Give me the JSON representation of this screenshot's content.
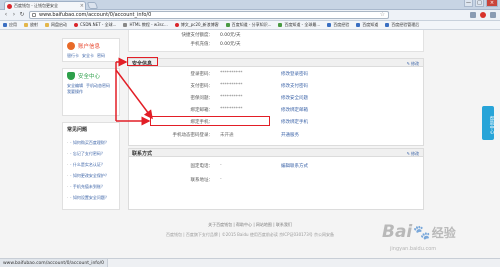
{
  "browser": {
    "tab_title": "百度钱包 - 让钱包更安全",
    "tab_close": "×",
    "window_controls": [
      "—",
      "□",
      "×"
    ],
    "url": "www.baifubao.com/account/0/account_info/0",
    "nav": {
      "back": "‹",
      "forward": "›",
      "reload": "↻"
    },
    "star": "☆",
    "bookmarks": [
      {
        "label": "应用",
        "icon": "apps-icon"
      },
      {
        "label": "放射",
        "icon": "folder-icon"
      },
      {
        "label": "网盘启动",
        "icon": "folder-icon"
      },
      {
        "label": "CSDN.NET - 全球...",
        "icon": "csdn-icon"
      },
      {
        "label": "HTML 教程 - w3sc...",
        "icon": "page-icon"
      },
      {
        "label": "博文_pc20_新浪博客",
        "icon": "weibo-icon"
      },
      {
        "label": "百度知道 - 分享知识...",
        "icon": "baidu-icon"
      },
      {
        "label": "百度知道 - 全球最...",
        "icon": "baidu-icon"
      },
      {
        "label": "百度经验",
        "icon": "baidu-icon"
      },
      {
        "label": "百度知道",
        "icon": "baidu-icon"
      },
      {
        "label": "百度经验管理后",
        "icon": "baidu-icon"
      }
    ]
  },
  "sidebar": {
    "account": {
      "title": "账户信息",
      "links": [
        "银行卡",
        "安全卡",
        "密码"
      ]
    },
    "security": {
      "title": "安全中心",
      "links_line1": [
        "安全编辑",
        "手机动态密码"
      ],
      "links_line2": [
        "我要操作"
      ]
    },
    "faq": {
      "title": "常见问题",
      "items": [
        "· 如何购买百度理财？",
        "· 忘记了支付密码？",
        "· 什么是实名认证？",
        "· 如何更改安全保护？",
        "· 手机充值未到账？",
        "· 如何设置安全问题？"
      ]
    }
  },
  "top_rows": [
    {
      "label": "快捷支付额度：",
      "value": "0.00元/天"
    },
    {
      "label": "手机充值：",
      "value": "0.00元/天"
    }
  ],
  "security_panel": {
    "title": "安全信息",
    "edit": "修改",
    "rows": [
      {
        "label": "登录密码：",
        "value": "**********",
        "action": "修改登录密码"
      },
      {
        "label": "支付密码：",
        "value": "**********",
        "action": "修改支付密码"
      },
      {
        "label": "密保问题：",
        "value": "**********",
        "action": "修改安全问题"
      },
      {
        "label": "绑定邮箱：",
        "value": "**********",
        "action": "修改绑定邮箱"
      },
      {
        "label": "绑定手机：",
        "value": "",
        "action": "修改绑定手机"
      },
      {
        "label": "手机动态密码登录：",
        "value": "未开通",
        "action": "开通服务"
      }
    ]
  },
  "contact_panel": {
    "title": "联系方式",
    "edit": "修改",
    "rows": [
      {
        "label": "固定电话：",
        "value": "-",
        "action": "编辑联系方式"
      },
      {
        "label": "联系地址：",
        "value": "-",
        "action": ""
      }
    ]
  },
  "float_help": "帮助中心",
  "footer": {
    "links": "关于百度钱包 | 帮助中心 | 网站地图 | 联系我们",
    "copyright": "百度钱包 | 百度旗下支付品牌  |  ©2015 Baidu 使用百度前必读  京ICP证030173号  京公网安备"
  },
  "watermark": {
    "brand": "Bai",
    "paw": "🐾",
    "suffix": "经验",
    "sub": "jingyan.baidu.com"
  },
  "status": {
    "url": "www.baifubao.com/account/0/account_info/0"
  },
  "annotation_color": "#e21e26"
}
